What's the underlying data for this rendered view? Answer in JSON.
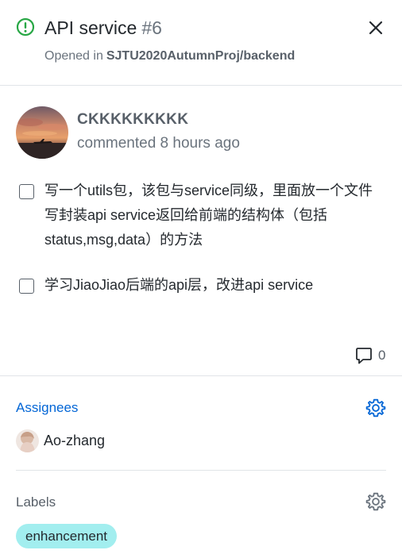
{
  "issue": {
    "title": "API service",
    "number": "#6",
    "opened_prefix": "Opened in",
    "repo": "SJTU2020AutumnProj/backend",
    "status_color": "#28a745"
  },
  "comment": {
    "author": "CKKKKKKKKK",
    "timestamp": "commented 8 hours ago",
    "tasks": [
      {
        "checked": false,
        "text": "写一个utils包，该包与service同级，里面放一个文件写封装api service返回给前端的结构体（包括status,msg,data）的方法"
      },
      {
        "checked": false,
        "text": "学习JiaoJiao后端的api层，改进api service"
      }
    ],
    "comment_count": "0"
  },
  "sidebar": {
    "assignees_title": "Assignees",
    "assignees": [
      {
        "name": "Ao-zhang"
      }
    ],
    "labels_title": "Labels",
    "labels": [
      {
        "name": "enhancement",
        "color": "#a2eeef"
      }
    ]
  },
  "colors": {
    "link_blue": "#0366d6",
    "muted": "#6a737d"
  }
}
